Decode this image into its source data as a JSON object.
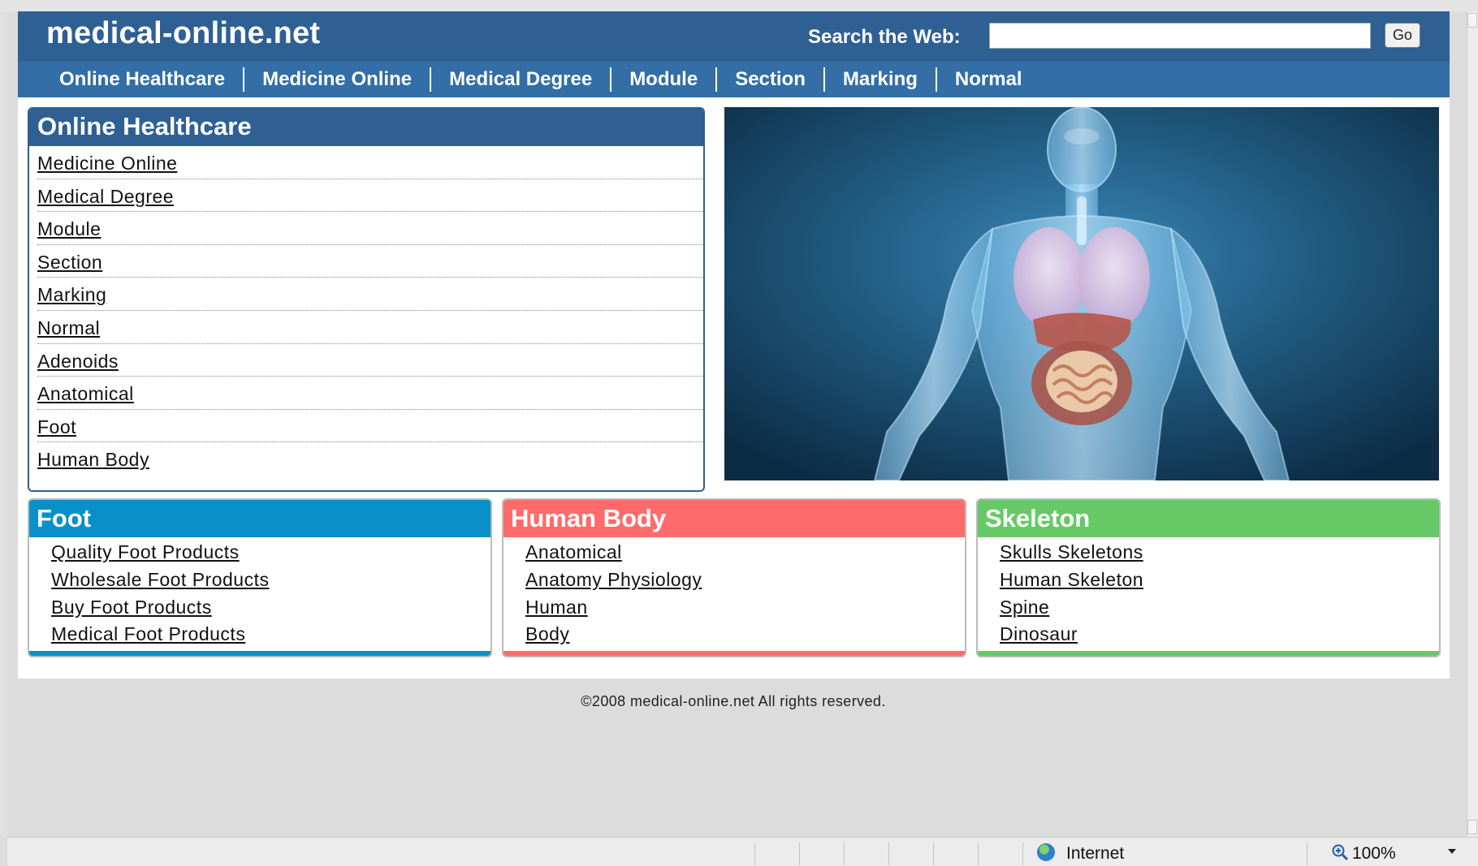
{
  "header": {
    "logo": "medical-online.net",
    "search_label": "Search the Web:",
    "search_value": "",
    "go_label": "Go"
  },
  "nav": {
    "items": [
      "Online Healthcare",
      "Medicine Online",
      "Medical Degree",
      "Module",
      "Section",
      "Marking",
      "Normal"
    ]
  },
  "main_box": {
    "title": "Online Healthcare",
    "links": [
      "Medicine Online",
      "Medical Degree",
      "Module",
      "Section",
      "Marking",
      "Normal",
      "Adenoids",
      "Anatomical",
      "Foot",
      "Human Body"
    ]
  },
  "categories": [
    {
      "title": "Foot",
      "color": "#0a90c8",
      "links": [
        "Quality Foot Products",
        "Wholesale Foot Products",
        "Buy Foot Products",
        "Medical Foot Products"
      ]
    },
    {
      "title": "Human Body",
      "color": "#ff6b6b",
      "links": [
        "Anatomical",
        "Anatomy Physiology",
        "Human",
        "Body"
      ]
    },
    {
      "title": "Skeleton",
      "color": "#66c966",
      "links": [
        "Skulls Skeletons",
        "Human Skeleton",
        "Spine",
        "Dinosaur"
      ]
    }
  ],
  "footer": {
    "copyright": "©2008 medical-online.net All rights reserved."
  },
  "statusbar": {
    "zone": "Internet",
    "zoom": "100%"
  },
  "colors": {
    "header_bg": "#2e6094",
    "nav_bg": "#336ea6"
  }
}
